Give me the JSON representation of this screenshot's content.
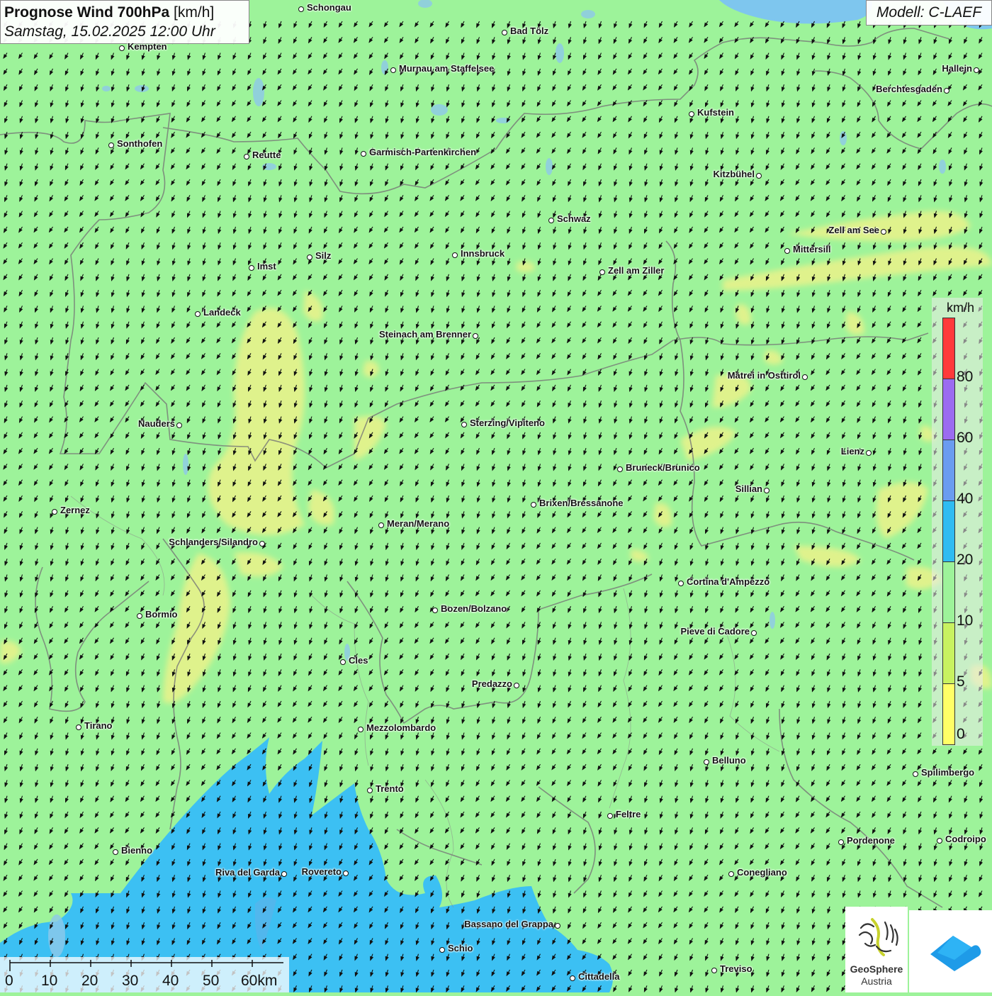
{
  "title": {
    "main": "Prognose Wind 700hPa",
    "unit": "[km/h]",
    "datetime": "Samstag, 15.02.2025 12:00 Uhr"
  },
  "model": "Modell: C-LAEF",
  "legend": {
    "unit": "km/h",
    "labels": [
      "80",
      "60",
      "40",
      "20",
      "10",
      "5",
      "0"
    ],
    "colors": [
      "#ff3a3a",
      "#9b6cf0",
      "#6a9cf0",
      "#2fbcf2",
      "#9df39a",
      "#c8f260",
      "#ffff66"
    ]
  },
  "scalebar": {
    "labels": [
      "0",
      "10",
      "20",
      "30",
      "40",
      "50",
      "60km"
    ]
  },
  "logos": {
    "geosphere_line1": "GeoSphere",
    "geosphere_line2": "Austria"
  },
  "map_colors": {
    "base": "#9df39a",
    "yellow": "#e3f28c",
    "blue": "#3cc0f3",
    "lake": "#7ec6ee"
  },
  "wind": {
    "direction": "north-northwest to south-southeast",
    "speed_band_kmh": "10-20"
  },
  "cities": [
    {
      "name": "Schongau",
      "label_side": "right"
    },
    {
      "name": "Bad Tölz",
      "label_side": "right"
    },
    {
      "name": "Kempten",
      "label_side": "right"
    },
    {
      "name": "Murnau am Staffelsee",
      "label_side": "right"
    },
    {
      "name": "Hallein",
      "label_side": "left"
    },
    {
      "name": "Berchtesgaden",
      "label_side": "left"
    },
    {
      "name": "Kufstein",
      "label_side": "right"
    },
    {
      "name": "Sonthofen",
      "label_side": "right"
    },
    {
      "name": "Reutte",
      "label_side": "right"
    },
    {
      "name": "Garmisch-Partenkirchen",
      "label_side": "right"
    },
    {
      "name": "Kitzbühel",
      "label_side": "left"
    },
    {
      "name": "Schwaz",
      "label_side": "right"
    },
    {
      "name": "Zell am See",
      "label_side": "left"
    },
    {
      "name": "Mittersill",
      "label_side": "right"
    },
    {
      "name": "Innsbruck",
      "label_side": "right"
    },
    {
      "name": "Silz",
      "label_side": "right"
    },
    {
      "name": "Imst",
      "label_side": "right"
    },
    {
      "name": "Zell am Ziller",
      "label_side": "right"
    },
    {
      "name": "Landeck",
      "label_side": "right"
    },
    {
      "name": "Steinach am Brenner",
      "label_side": "left"
    },
    {
      "name": "Matrei in Osttirol",
      "label_side": "left"
    },
    {
      "name": "Nauders",
      "label_side": "left"
    },
    {
      "name": "Sterzing/Vipiteno",
      "label_side": "right"
    },
    {
      "name": "Lienz",
      "label_side": "left"
    },
    {
      "name": "Bruneck/Brunico",
      "label_side": "right"
    },
    {
      "name": "Sillian",
      "label_side": "left"
    },
    {
      "name": "Zernez",
      "label_side": "right"
    },
    {
      "name": "Brixen/Bressanone",
      "label_side": "right"
    },
    {
      "name": "Meran/Merano",
      "label_side": "right"
    },
    {
      "name": "Schlanders/Silandro",
      "label_side": "left"
    },
    {
      "name": "Cortina d'Ampezzo",
      "label_side": "right"
    },
    {
      "name": "Bozen/Bolzano",
      "label_side": "right"
    },
    {
      "name": "Bormio",
      "label_side": "right"
    },
    {
      "name": "Pieve di Cadore",
      "label_side": "left"
    },
    {
      "name": "Cles",
      "label_side": "right"
    },
    {
      "name": "Predazzo",
      "label_side": "left"
    },
    {
      "name": "Tirano",
      "label_side": "right"
    },
    {
      "name": "Mezzolombardo",
      "label_side": "right"
    },
    {
      "name": "Belluno",
      "label_side": "right"
    },
    {
      "name": "Spilimbergo",
      "label_side": "right"
    },
    {
      "name": "Trento",
      "label_side": "right"
    },
    {
      "name": "Feltre",
      "label_side": "right"
    },
    {
      "name": "Pordenone",
      "label_side": "right"
    },
    {
      "name": "Codroipo",
      "label_side": "right"
    },
    {
      "name": "Bienno",
      "label_side": "right"
    },
    {
      "name": "Riva del Garda",
      "label_side": "left"
    },
    {
      "name": "Rovereto",
      "label_side": "left"
    },
    {
      "name": "Conegliano",
      "label_side": "right"
    },
    {
      "name": "Bassano del Grappa",
      "label_side": "left"
    },
    {
      "name": "Schio",
      "label_side": "right"
    },
    {
      "name": "Treviso",
      "label_side": "right"
    },
    {
      "name": "Cittadella",
      "label_side": "right"
    }
  ]
}
